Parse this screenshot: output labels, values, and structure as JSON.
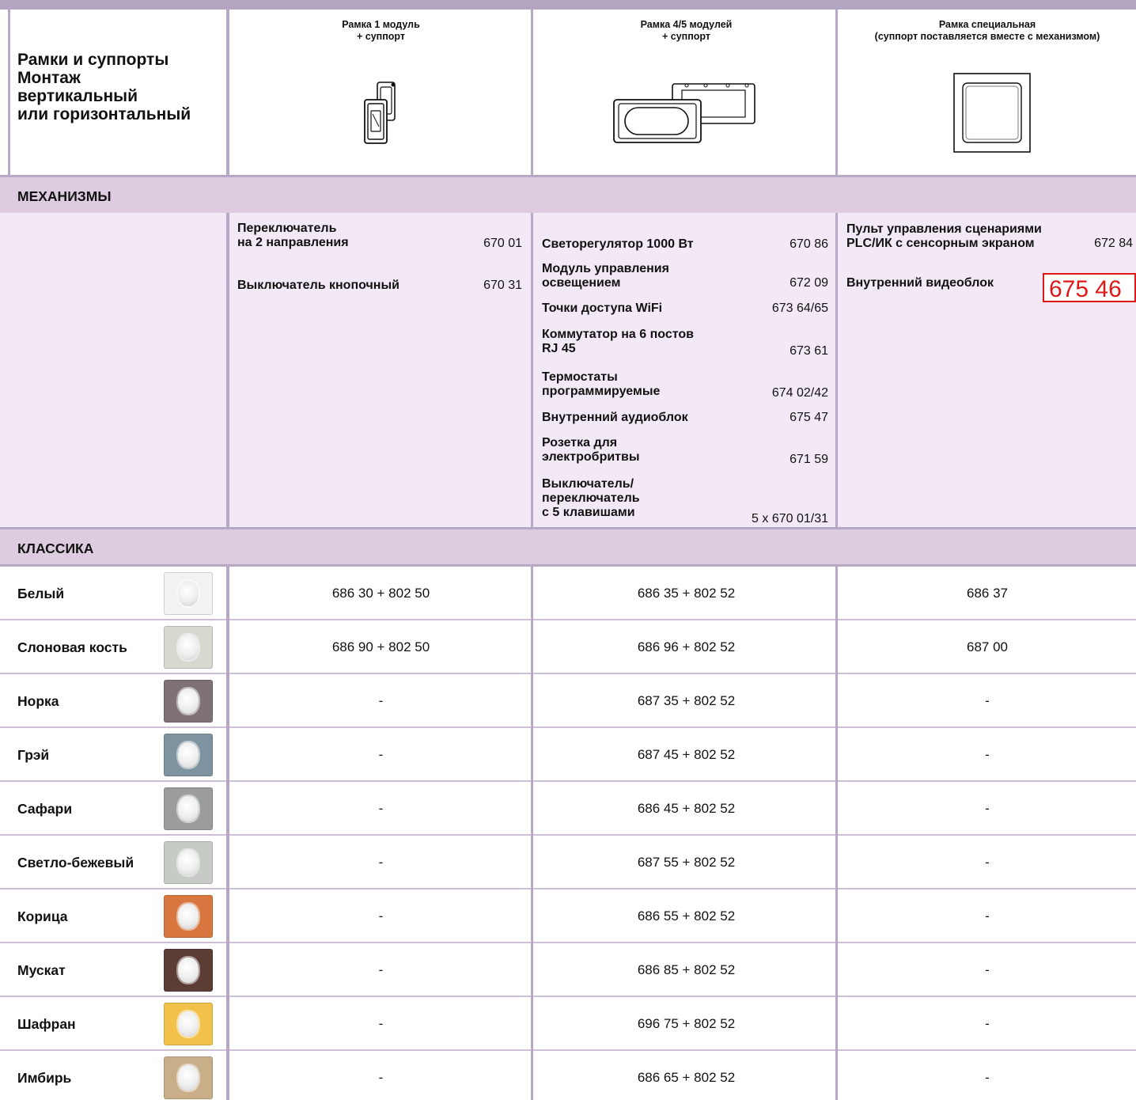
{
  "header": {
    "title_lines": [
      "Рамки и суппорты",
      "Монтаж",
      "вертикальный",
      "или горизонтальный"
    ],
    "col1": [
      "Рамка 1 модуль",
      "+ суппорт"
    ],
    "col2": [
      "Рамка 4/5 модулей",
      "+ суппорт"
    ],
    "col3": [
      "Рамка специальная",
      "(суппорт поставляется вместе с механизмом)"
    ]
  },
  "sections": {
    "mechanisms": "МЕХАНИЗМЫ",
    "classic": "КЛАССИКА"
  },
  "mechanisms": {
    "col1": [
      {
        "lines": [
          "Переключатель",
          "на 2 направления"
        ],
        "code": "670 01"
      },
      {
        "lines": [
          "Выключатель кнопочный"
        ],
        "code": "670 31"
      }
    ],
    "col2": [
      {
        "lines": [
          "Светорегулятор 1000 Вт"
        ],
        "code": "670 86"
      },
      {
        "lines": [
          "Модуль управления",
          "освещением"
        ],
        "code": "672 09"
      },
      {
        "lines": [
          "Точки доступа WiFi"
        ],
        "code": "673 64/65"
      },
      {
        "lines": [
          "Коммутатор на 6 постов",
          "RJ 45"
        ],
        "code": "673 61"
      },
      {
        "lines": [
          "Термостаты",
          "программируемые"
        ],
        "code": "674 02/42"
      },
      {
        "lines": [
          "Внутренний аудиоблок"
        ],
        "code": "675 47"
      },
      {
        "lines": [
          "Розетка для",
          "электробритвы"
        ],
        "code": "671 59"
      },
      {
        "lines": [
          "Выключатель/",
          "переключатель",
          "с 5 клавишами"
        ],
        "code": "5 x 670 01/31"
      }
    ],
    "col3": [
      {
        "lines": [
          "Пульт управления сценариями",
          "PLC/ИК с сенсорным экраном"
        ],
        "code": "672 84"
      },
      {
        "lines": [
          "Внутренний видеоблок"
        ],
        "code": "675 46"
      }
    ]
  },
  "rows": [
    {
      "name": "Белый",
      "color": "#f2f2f2",
      "c1": "686 30 + 802 50",
      "c2": "686 35 + 802 52",
      "c3": "686 37"
    },
    {
      "name": "Слоновая кость",
      "color": "#d6d9d0",
      "c1": "686 90 + 802 50",
      "c2": "686 96 + 802 52",
      "c3": "687 00"
    },
    {
      "name": "Норка",
      "color": "#7e7275",
      "c1": "-",
      "c2": "687 35 + 802 52",
      "c3": "-"
    },
    {
      "name": "Грэй",
      "color": "#7e93a0",
      "c1": "-",
      "c2": "687 45 + 802 52",
      "c3": "-"
    },
    {
      "name": "Сафари",
      "color": "#9b9c9c",
      "c1": "-",
      "c2": "686 45 + 802 52",
      "c3": "-"
    },
    {
      "name": "Светло-бежевый",
      "color": "#c7cbc5",
      "c1": "-",
      "c2": "687 55 + 802 52",
      "c3": "-"
    },
    {
      "name": "Корица",
      "color": "#d7763f",
      "c1": "-",
      "c2": "686 55 + 802 52",
      "c3": "-"
    },
    {
      "name": "Мускат",
      "color": "#5b3d35",
      "c1": "-",
      "c2": "686 85 + 802 52",
      "c3": "-"
    },
    {
      "name": "Шафран",
      "color": "#f2c14a",
      "c1": "-",
      "c2": "696 75 + 802 52",
      "c3": "-"
    },
    {
      "name": "Имбирь",
      "color": "#c9ae8a",
      "c1": "-",
      "c2": "686 65 + 802 52",
      "c3": "-"
    }
  ]
}
